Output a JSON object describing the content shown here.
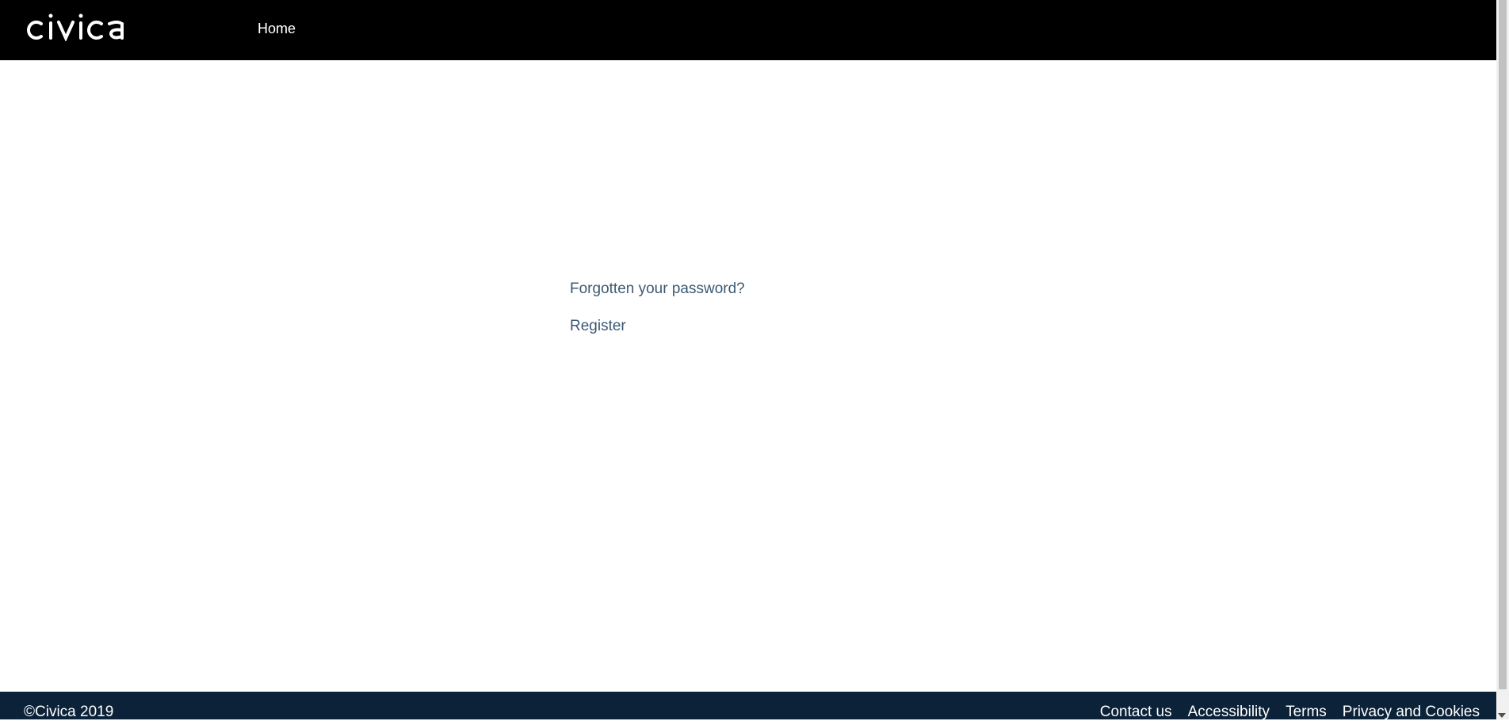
{
  "header": {
    "logo_text": "civica",
    "nav": {
      "home_label": "Home"
    }
  },
  "main": {
    "forgot_password_label": "Forgotten your password?",
    "register_label": "Register"
  },
  "footer": {
    "copyright": "©Civica 2019",
    "links": [
      {
        "label": "Contact us"
      },
      {
        "label": "Accessibility"
      },
      {
        "label": "Terms"
      },
      {
        "label": "Privacy and Cookies"
      }
    ]
  },
  "colors": {
    "header_bg": "#000000",
    "footer_bg": "#0b2238",
    "link": "#3d5a74"
  }
}
